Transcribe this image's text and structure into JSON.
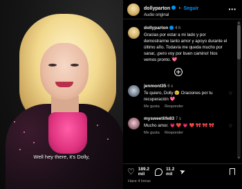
{
  "media": {
    "caption": "Well hey there, it's Dolly,"
  },
  "header": {
    "username": "dollyparton",
    "separator": "•",
    "follow_label": "Seguir",
    "audio_label": "Audio original",
    "more_icon": "more-horizontal-icon"
  },
  "post": {
    "username": "dollyparton",
    "time": "4 h",
    "text": "Gracias por estar a mi lado y por demostrarme tanto amor y apoyo durante el último año. Todavía me queda mucho por sanar, ¡pero voy por buen camino! Nos vemos pronto. 💖"
  },
  "comments": [
    {
      "username": "jenmont35",
      "time": "6 s",
      "text": "Te quiero, Dolly 😢 Oraciones por tu recuperación 💖",
      "like_label": "Me gusta",
      "reply_label": "Responder"
    },
    {
      "username": "mysweetlife83",
      "time": "7 s",
      "text": "Mucho amor. 💗 ❤️ 💗 ❤️ 🎀 🎀 🎀",
      "like_label": "Me gusta",
      "reply_label": "Responder"
    }
  ],
  "actions": {
    "likes": "189.2 mil",
    "likes_num": "189.2",
    "likes_unit": "mil",
    "comments_num": "11.2",
    "comments_unit": "mil",
    "time_ago": "Hace 4 horas"
  },
  "colors": {
    "accent": "#0095f6",
    "background": "#000000",
    "muted": "#a8a8a8"
  }
}
